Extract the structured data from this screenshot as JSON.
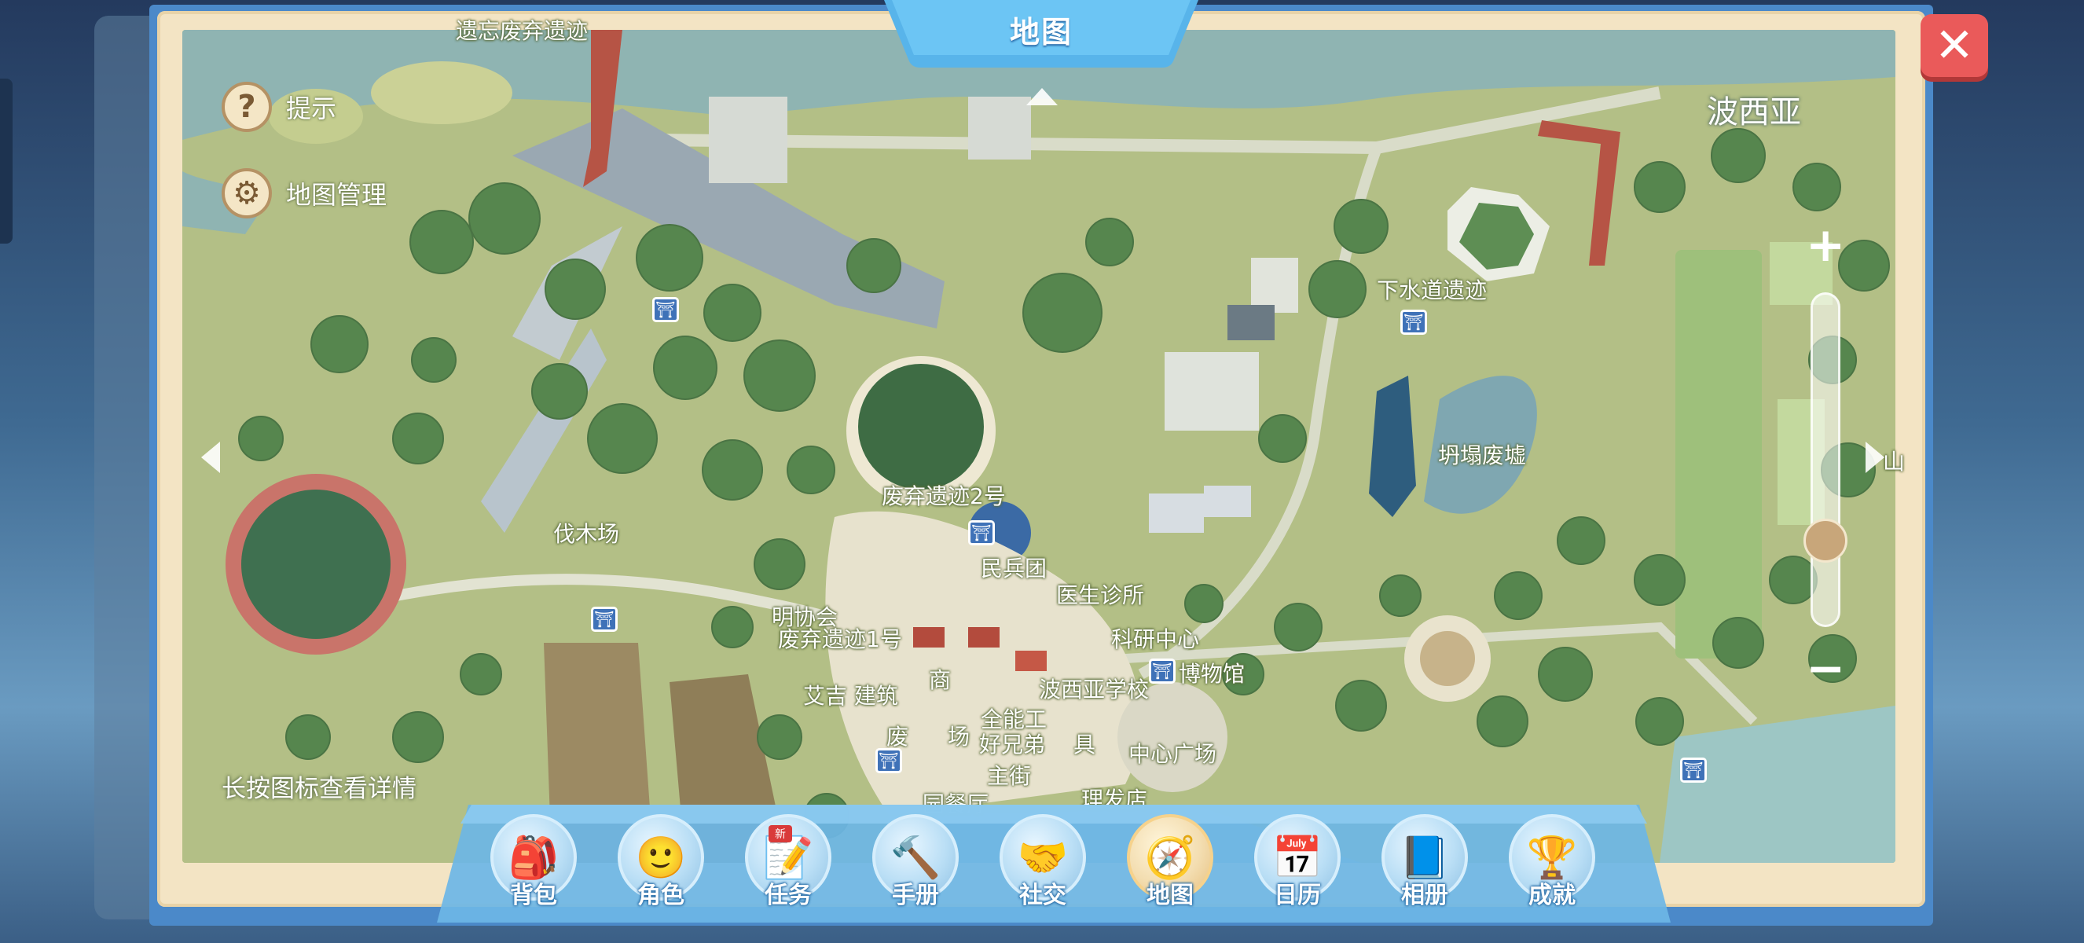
{
  "header": {
    "title": "地图"
  },
  "region_name": "波西亚",
  "side_menu": {
    "hint_label": "提示",
    "manage_label": "地图管理"
  },
  "hint_text": "长按图标查看详情",
  "map_labels": {
    "top_partial": "遗忘废弃遗迹",
    "lumber": "伐木场",
    "ruins2": "废弃遗迹2号",
    "militia": "民兵团",
    "clinic": "医生诊所",
    "research": "科研中心",
    "museum": "博物馆",
    "guild": "明协会",
    "ruins1": "废弃遗迹1号",
    "aiji": "艾吉 建筑",
    "shop": "商",
    "school": "波西亚学校",
    "omni": "全能工",
    "brothers": "好兄弟",
    "furniture": "具",
    "plaza_partial": "废",
    "plaza2": "场",
    "central_plaza": "中心广场",
    "main_street": "主街",
    "restaurant": "园餐厅",
    "barber": "理发店",
    "sewer": "下水道遗迹",
    "collapse": "坍塌废墟",
    "edge_right": "山"
  },
  "nav": [
    {
      "label": "背包",
      "icon": "backpack-icon",
      "glyph": "🎒"
    },
    {
      "label": "角色",
      "icon": "character-icon",
      "glyph": "🙂"
    },
    {
      "label": "任务",
      "icon": "quest-icon",
      "glyph": "📝",
      "badge": "新"
    },
    {
      "label": "手册",
      "icon": "handbook-icon",
      "glyph": "🔨"
    },
    {
      "label": "社交",
      "icon": "social-icon",
      "glyph": "🤝"
    },
    {
      "label": "地图",
      "icon": "map-icon",
      "glyph": "🧭"
    },
    {
      "label": "日历",
      "icon": "calendar-icon",
      "glyph": "📅"
    },
    {
      "label": "相册",
      "icon": "album-icon",
      "glyph": "📘"
    },
    {
      "label": "成就",
      "icon": "trophy-icon",
      "glyph": "🏆"
    }
  ],
  "colors": {
    "frame": "#4b89c9",
    "map_grass": "#b5c087",
    "close": "#ea5a5a"
  }
}
